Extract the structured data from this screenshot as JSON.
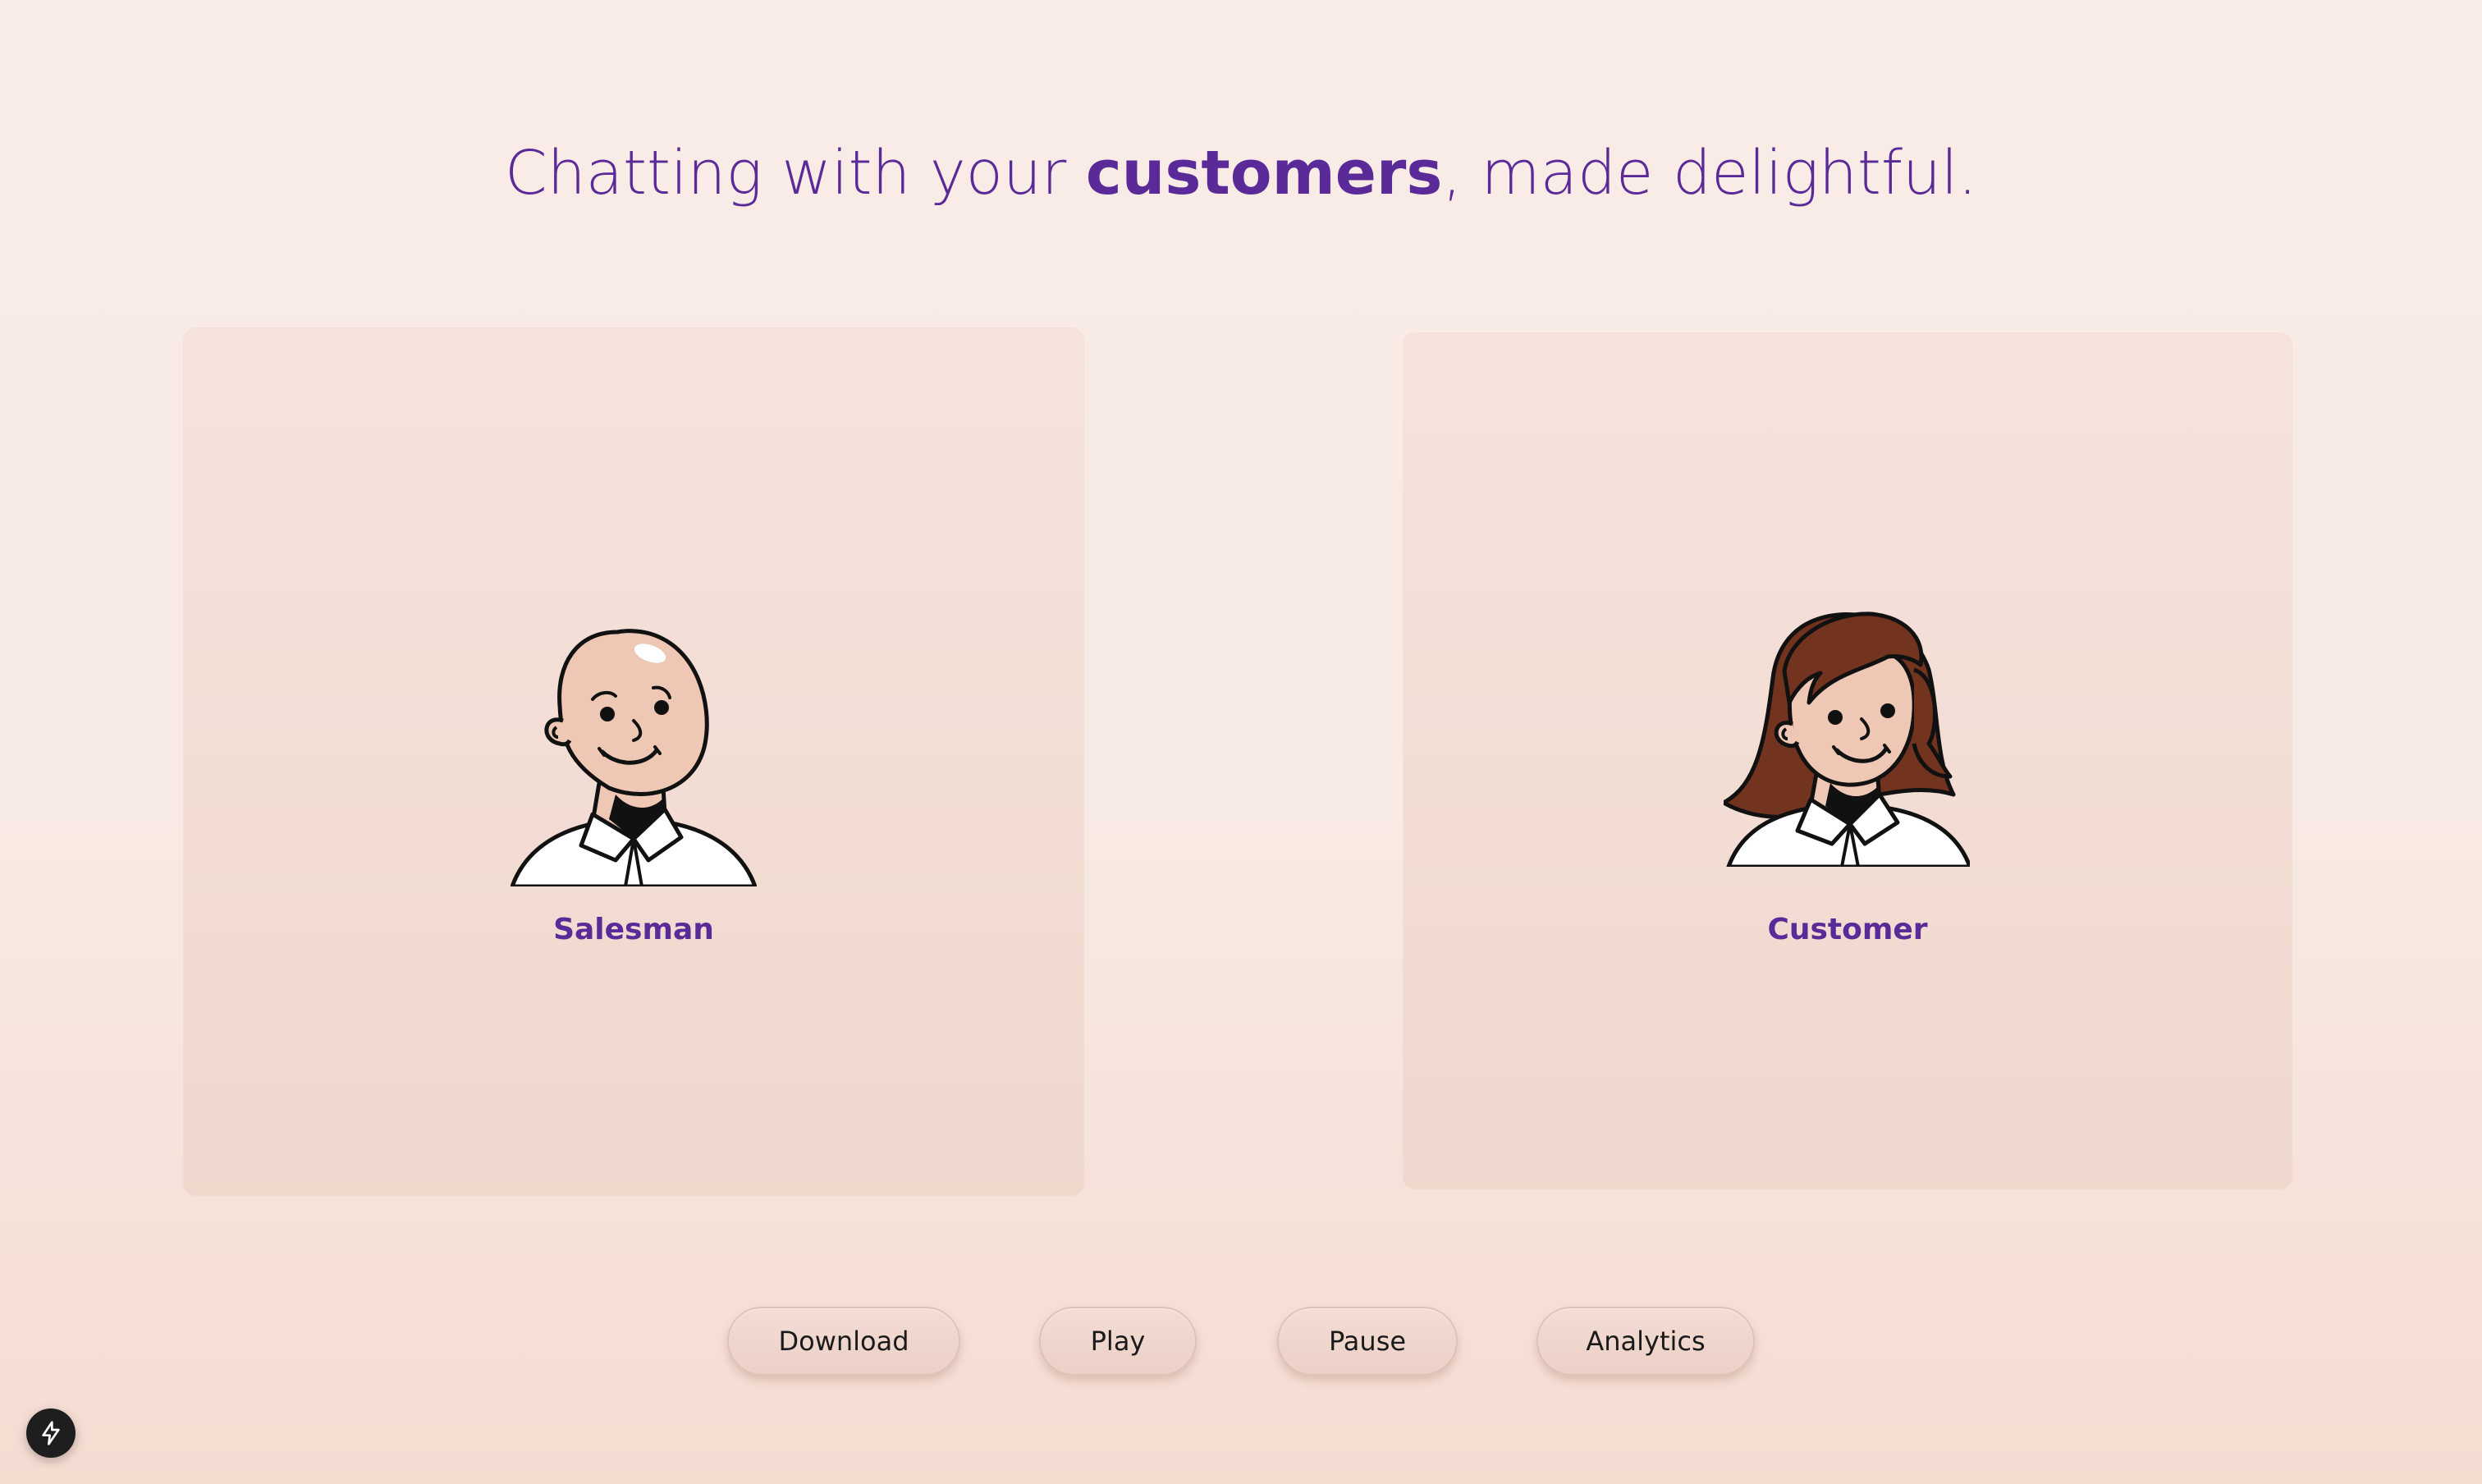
{
  "headline": {
    "prefix": "Chatting with your ",
    "emphasis": "customers",
    "suffix": ", made delightful."
  },
  "participants": [
    {
      "label": "Salesman",
      "icon": "bald-man-avatar-icon"
    },
    {
      "label": "Customer",
      "icon": "woman-avatar-icon"
    }
  ],
  "controls": {
    "download_label": "Download",
    "play_label": "Play",
    "pause_label": "Pause",
    "analytics_label": "Analytics"
  },
  "badge": {
    "icon": "lightning-bolt-icon"
  },
  "colors": {
    "accent": "#5a2a98",
    "skin": "#efc7b5",
    "hair": "#73341f",
    "badge_bg": "#1e1e1e"
  }
}
